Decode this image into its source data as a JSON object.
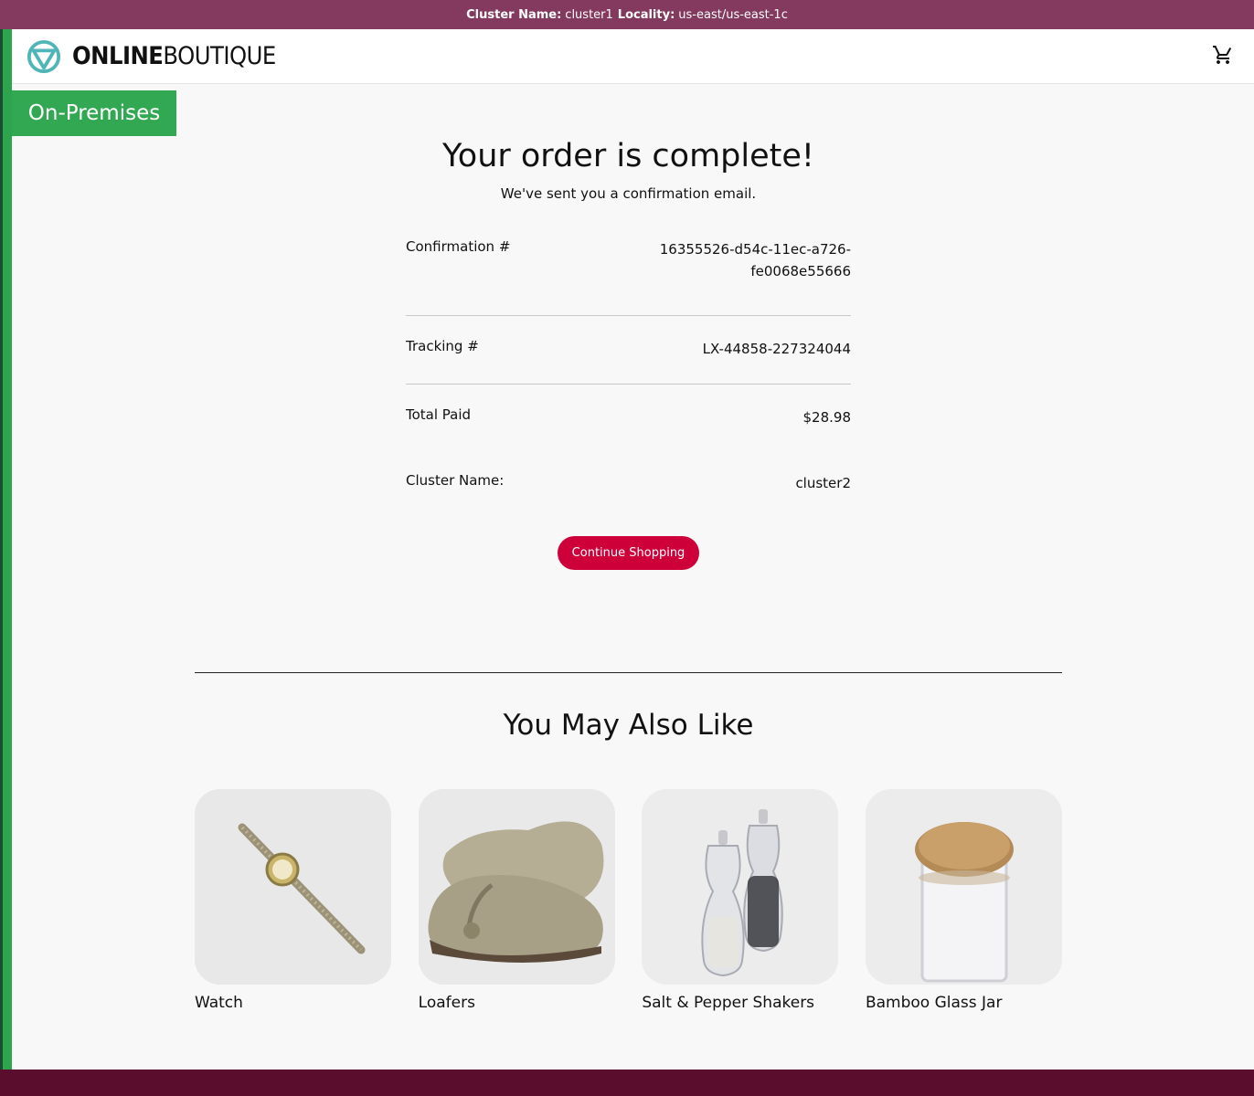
{
  "cluster_bar": {
    "cluster_label": "Cluster Name:",
    "cluster_value": "cluster1",
    "locality_label": "Locality:",
    "locality_value": "us-east/us-east-1c",
    "bg_color": "#84395e"
  },
  "header": {
    "logo_bold": "ONLINE",
    "logo_light": "BOUTIQUE",
    "cart_icon": "cart-icon"
  },
  "platform_badge": {
    "label": "On-Premises",
    "color": "#33a853"
  },
  "order": {
    "title": "Your order is complete!",
    "subtitle": "We've sent you a confirmation email.",
    "rows": [
      {
        "label": "Confirmation #",
        "value_line1": "16355526-d54c-11ec-a726-",
        "value_line2": "fe0068e55666"
      },
      {
        "label": "Tracking #",
        "value": "LX-44858-227324044"
      },
      {
        "label": "Total Paid",
        "value": "$28.98"
      },
      {
        "label": "Cluster Name:",
        "value": "cluster2"
      }
    ],
    "continue_label": "Continue Shopping",
    "accent_color": "#cd0039"
  },
  "recommendations": {
    "title": "You May Also Like",
    "items": [
      {
        "name": "Watch",
        "icon": "watch-image"
      },
      {
        "name": "Loafers",
        "icon": "loafers-image"
      },
      {
        "name": "Salt & Pepper Shakers",
        "icon": "shakers-image"
      },
      {
        "name": "Bamboo Glass Jar",
        "icon": "jar-image"
      }
    ]
  },
  "footer": {
    "color": "#5b0d2e"
  }
}
